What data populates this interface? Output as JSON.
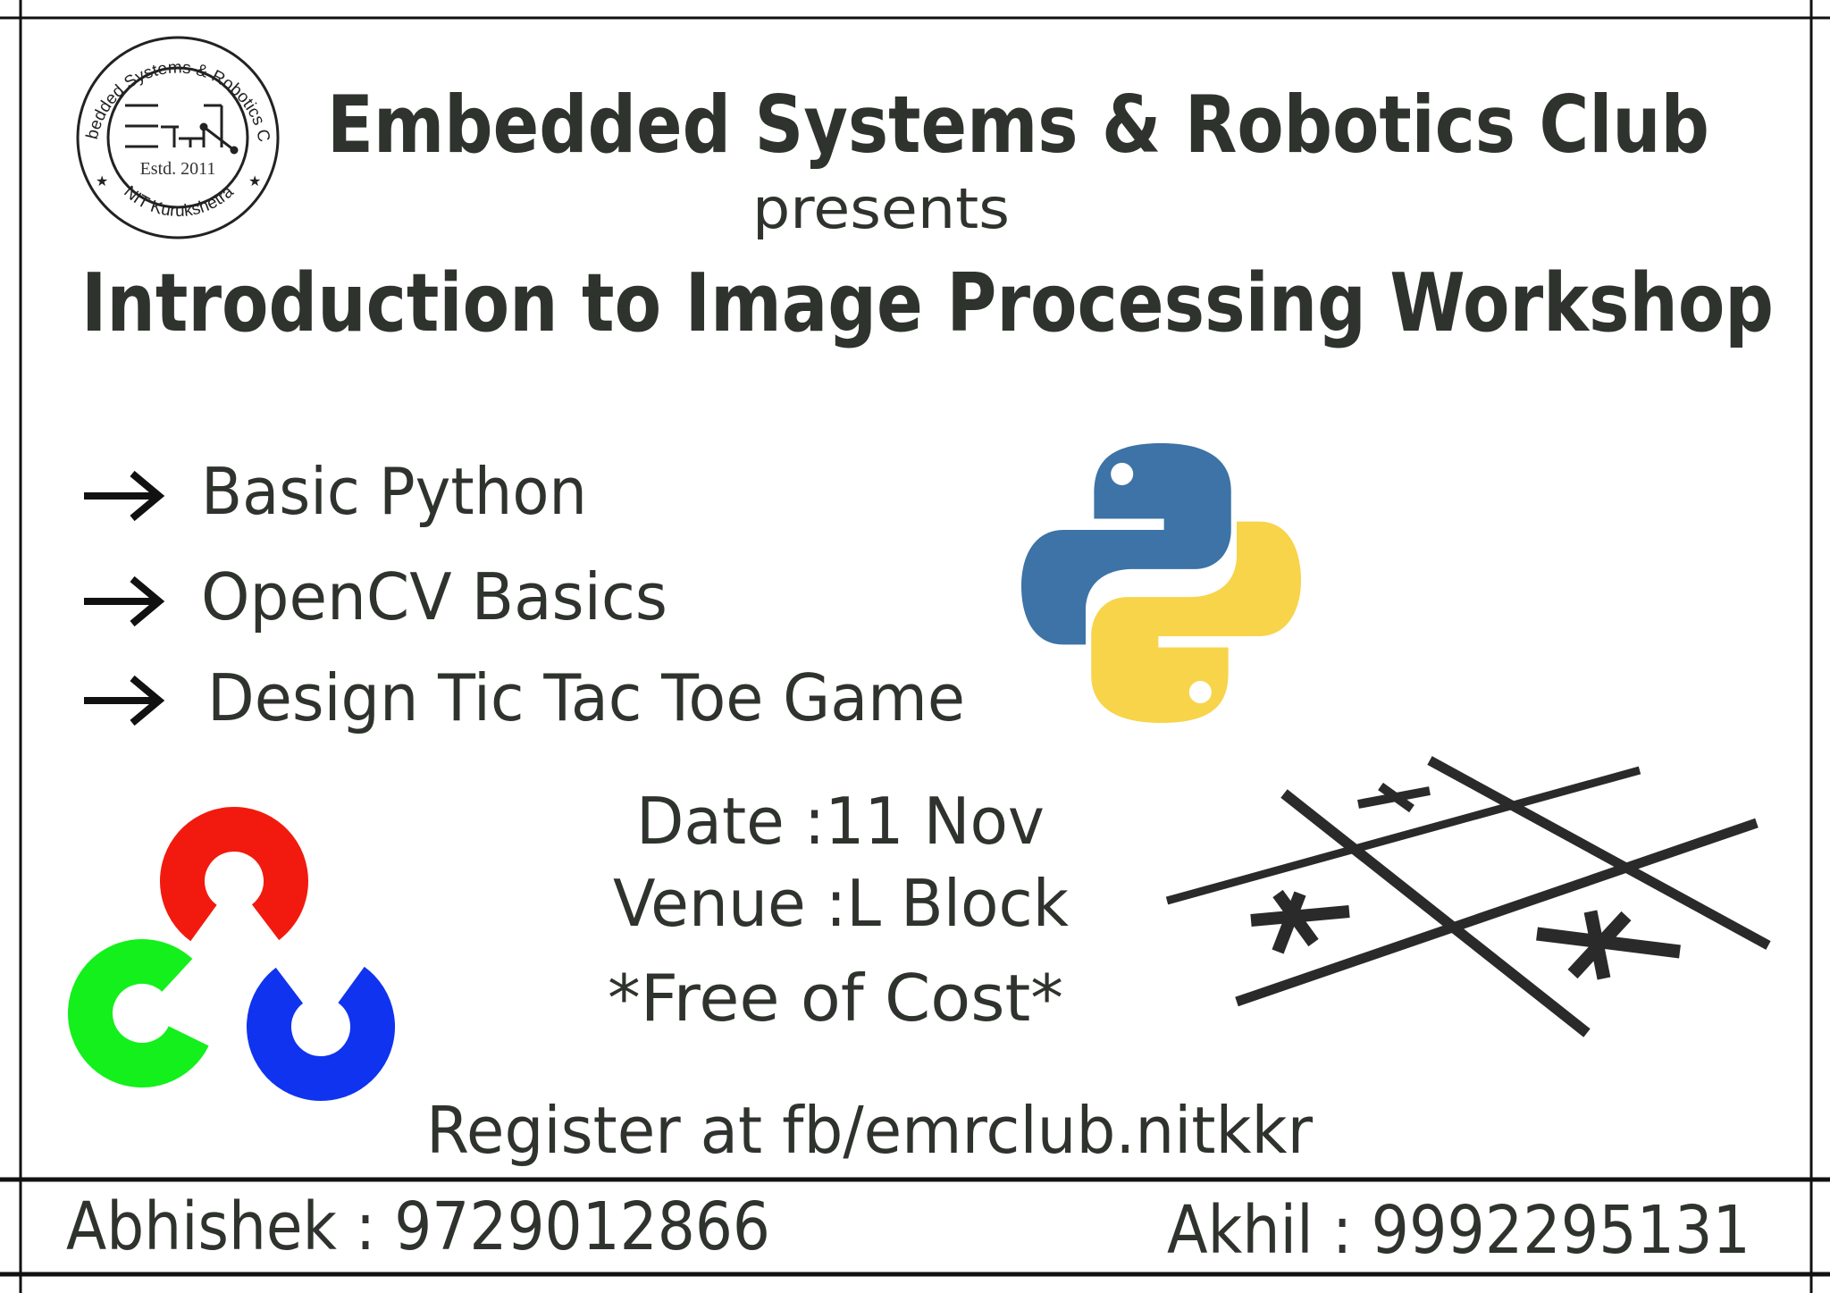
{
  "logo": {
    "ring_text_top": "Embedded Systems & Robotics Club",
    "ring_text_bottom": "NIT Kurukshetra",
    "established": "Estd. 2011"
  },
  "header": {
    "club_name": "Embedded Systems & Robotics Club",
    "presents": "presents",
    "event_title": "Introduction to Image Processing Workshop"
  },
  "topics": [
    {
      "icon": "arrow-right-icon",
      "label": "Basic Python"
    },
    {
      "icon": "arrow-right-icon",
      "label": "OpenCV Basics"
    },
    {
      "icon": "arrow-right-icon",
      "label": "Design Tic Tac Toe Game"
    }
  ],
  "details": {
    "date": "Date :11 Nov",
    "venue": "Venue :L Block",
    "cost": "*Free of Cost*"
  },
  "register": "Register at fb/emrclub.nitkkr",
  "contacts": [
    {
      "text": "Abhishek : 9729012866"
    },
    {
      "text": "Akhil : 9992295131"
    }
  ],
  "colors": {
    "text": "#2f332d",
    "python_blue": "#3d73a6",
    "python_yellow": "#f7d44a",
    "opencv_red": "#f21a0f",
    "opencv_green": "#13f01b",
    "opencv_blue": "#0f33ef"
  }
}
